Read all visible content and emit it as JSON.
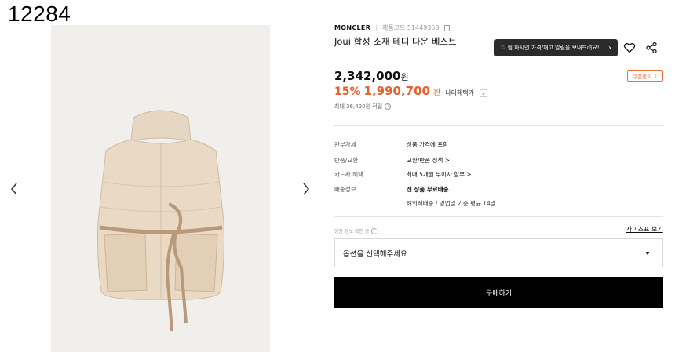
{
  "screenshot_id": "12284",
  "product": {
    "brand": "MONCLER",
    "code_label": "제품코드 51449358",
    "title": "Joui 합성 소재 테디 다운 베스트",
    "notify_text": "♡ 찜 하시면 가격/재고 알림을 보내드려요!",
    "original_price": "2,342,000",
    "price_unit": "원",
    "coupon_label": "쿠폰받기 ⇩",
    "discount_rate": "15%",
    "sale_price": "1,990,700",
    "sale_unit": "원",
    "benefit_label": "나의혜택가",
    "points_text": "최대 36,420원 적립"
  },
  "info": {
    "duty": {
      "key": "관부가세",
      "value": "상품 가격에 포함"
    },
    "exchange": {
      "key": "반품/교환",
      "value": "교환/반품 정책 >"
    },
    "card": {
      "key": "카드사 혜택",
      "value": "최대 5개월 무이자 할부 >"
    },
    "shipping": {
      "key": "배송정보",
      "value": "전 상품 무료배송",
      "sub": "해외직배송 / 영업일 기준 평균 14일"
    }
  },
  "options": {
    "stock_label": "상품 정보 확인 중",
    "size_chart": "사이즈표 보기",
    "select_placeholder": "옵션을 선택해주세요",
    "buy_label": "구매하기"
  },
  "icons": {
    "prev": "chevron-left-icon",
    "next": "chevron-right-icon",
    "wishlist": "heart-icon",
    "share": "share-icon",
    "copy": "copy-icon",
    "info": "info-icon",
    "refresh": "refresh-icon",
    "dropdown": "caret-down-icon"
  },
  "colors": {
    "accent": "#e8602c",
    "notify_bg": "#2b2b2b",
    "buy_bg": "#000000",
    "image_bg": "#f1efec"
  }
}
